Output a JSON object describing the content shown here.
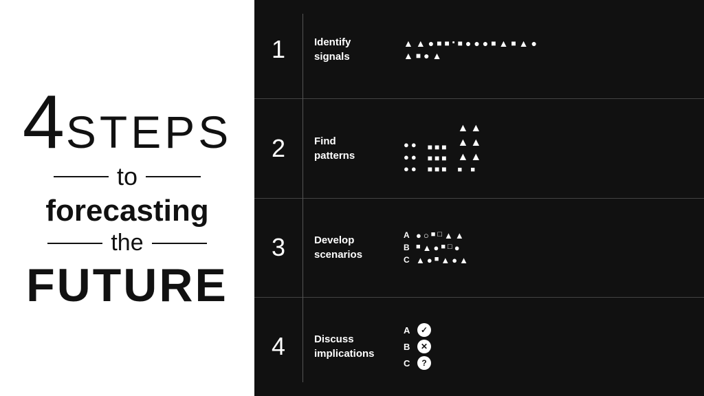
{
  "left": {
    "number": "4",
    "steps": "STEPS",
    "to": "to",
    "forecasting": "forecasting",
    "the": "the",
    "future": "FUTURE"
  },
  "steps": [
    {
      "number": "1",
      "label": "Identify\nsignals",
      "visual_type": "scatter"
    },
    {
      "number": "2",
      "label": "Find\npatterns",
      "visual_type": "patterns"
    },
    {
      "number": "3",
      "label": "Develop\nscenarios",
      "visual_type": "scenarios",
      "rows": [
        {
          "letter": "A",
          "shapes": [
            "●",
            "○",
            "■",
            "□",
            "▲",
            "▲"
          ]
        },
        {
          "letter": "B",
          "shapes": [
            "■",
            "▲",
            "●",
            "■",
            "□",
            "●"
          ]
        },
        {
          "letter": "C",
          "shapes": [
            "▲",
            "●",
            "■",
            "▲",
            "●",
            "▲"
          ]
        }
      ]
    },
    {
      "number": "4",
      "label": "Discuss\nimplications",
      "visual_type": "implications",
      "rows": [
        {
          "letter": "A",
          "icon": "check"
        },
        {
          "letter": "B",
          "icon": "x"
        },
        {
          "letter": "C",
          "icon": "question"
        }
      ]
    }
  ]
}
